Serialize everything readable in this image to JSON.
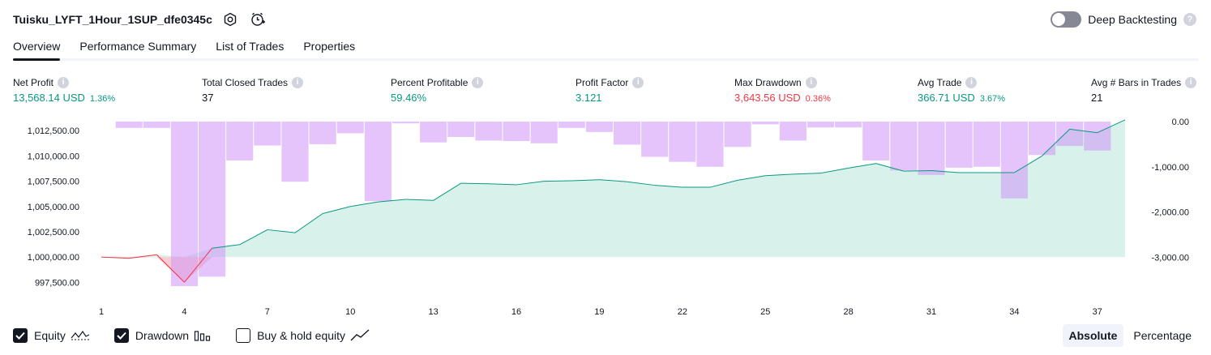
{
  "header": {
    "strategy_title": "Tuisku_LYFT_1Hour_1SUP_dfe0345c",
    "settings_icon": "gear-icon",
    "alert_icon": "add-alert-icon",
    "deep_backtesting_label": "Deep Backtesting",
    "deep_backtesting_enabled": false,
    "help_glyph": "?"
  },
  "tabs": [
    {
      "label": "Overview",
      "active": true
    },
    {
      "label": "Performance Summary",
      "active": false
    },
    {
      "label": "List of Trades",
      "active": false
    },
    {
      "label": "Properties",
      "active": false
    }
  ],
  "metrics": {
    "info_glyph": "i",
    "net_profit": {
      "label": "Net Profit",
      "value": "13,568.14 USD",
      "percent": "1.36%"
    },
    "total_closed_trades": {
      "label": "Total Closed Trades",
      "value": "37"
    },
    "percent_profitable": {
      "label": "Percent Profitable",
      "value": "59.46%"
    },
    "profit_factor": {
      "label": "Profit Factor",
      "value": "3.121"
    },
    "max_drawdown": {
      "label": "Max Drawdown",
      "value": "3,643.56 USD",
      "percent": "0.36%"
    },
    "avg_trade": {
      "label": "Avg Trade",
      "value": "366.71 USD",
      "percent": "3.67%"
    },
    "avg_bars": {
      "label": "Avg # Bars in Trades",
      "value": "21"
    }
  },
  "chart_data": {
    "type": "area",
    "x": [
      1,
      2,
      3,
      4,
      5,
      6,
      7,
      8,
      9,
      10,
      11,
      12,
      13,
      14,
      15,
      16,
      17,
      18,
      19,
      20,
      21,
      22,
      23,
      24,
      25,
      26,
      27,
      28,
      29,
      30,
      31,
      32,
      33,
      34,
      35,
      36,
      37,
      38
    ],
    "x_ticks": [
      1,
      4,
      7,
      10,
      13,
      16,
      19,
      22,
      25,
      28,
      31,
      34,
      37
    ],
    "series": [
      {
        "name": "Equity",
        "axis": "left",
        "color": "#089981",
        "fill": "#d2efe7",
        "negative_color": "#f23645",
        "values": [
          1000000,
          999880,
          1000230,
          997500,
          1000870,
          1001230,
          1002700,
          1002400,
          1004300,
          1005000,
          1005450,
          1005700,
          1005600,
          1007300,
          1007250,
          1007150,
          1007500,
          1007550,
          1007650,
          1007450,
          1007100,
          1006900,
          1006900,
          1007600,
          1008050,
          1008200,
          1008300,
          1008800,
          1009250,
          1008500,
          1008550,
          1008350,
          1008350,
          1008350,
          1010000,
          1012650,
          1012300,
          1013568.14
        ]
      },
      {
        "name": "Drawdown",
        "axis": "right",
        "color": "#ce93f8",
        "opacity": 0.55,
        "values": [
          0,
          -140,
          -140,
          -3640,
          -3430,
          -860,
          -530,
          -1330,
          -500,
          -260,
          -1760,
          -40,
          -460,
          -340,
          -420,
          -430,
          -480,
          -140,
          -230,
          -510,
          -780,
          -890,
          -1000,
          -560,
          -60,
          -420,
          -130,
          -130,
          -860,
          -1080,
          -1180,
          -1020,
          -1000,
          -1700,
          -740,
          -540,
          -640,
          0
        ]
      }
    ],
    "y_left": {
      "min": 996400,
      "max": 1013400,
      "ticks": [
        1012500,
        1010000,
        1007500,
        1005000,
        1002500,
        1000000,
        997500
      ],
      "tick_labels": [
        "1,012,500.00",
        "1,010,000.00",
        "1,007,500.00",
        "1,005,000.00",
        "1,002,500.00",
        "1,000,000.00",
        "997,500.00"
      ]
    },
    "y_right": {
      "min": -3800,
      "max": 0,
      "ticks": [
        0,
        -1000,
        -2000,
        -3000
      ],
      "tick_labels": [
        "0.00",
        "-1,000.00",
        "-2,000.00",
        "-3,000.00"
      ]
    }
  },
  "legend": {
    "equity": {
      "label": "Equity",
      "checked": true,
      "icon": "equity-line-icon"
    },
    "drawdown": {
      "label": "Drawdown",
      "checked": true,
      "icon": "bars-icon"
    },
    "buy_hold": {
      "label": "Buy & hold equity",
      "checked": false,
      "icon": "trend-line-icon"
    }
  },
  "modes": [
    {
      "label": "Absolute",
      "active": true
    },
    {
      "label": "Percentage",
      "active": false
    }
  ]
}
